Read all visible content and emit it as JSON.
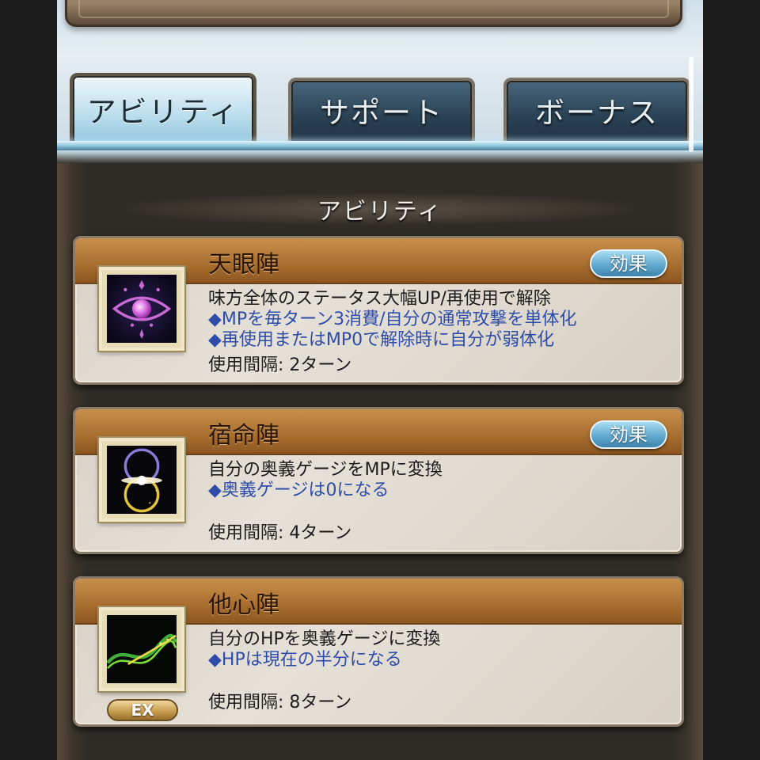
{
  "tabs": [
    {
      "label": "アビリティ",
      "active": true
    },
    {
      "label": "サポート",
      "active": false
    },
    {
      "label": "ボーナス",
      "active": false
    }
  ],
  "section_title": "アビリティ",
  "effect_label": "効果",
  "abilities": [
    {
      "name": "天眼陣",
      "has_effect_button": true,
      "lines": [
        {
          "text": "味方全体のステータス大幅UP/再使用で解除",
          "style": "normal"
        },
        {
          "text": "◆MPを毎ターン3消費/自分の通常攻撃を単体化",
          "style": "blue"
        },
        {
          "text": "◆再使用またはMP0で解除時に自分が弱体化",
          "style": "blue"
        }
      ],
      "interval": "使用間隔: 2ターン",
      "icon": "eye-icon"
    },
    {
      "name": "宿命陣",
      "has_effect_button": true,
      "lines": [
        {
          "text": "自分の奥義ゲージをMPに変換",
          "style": "normal"
        },
        {
          "text": "◆奥義ゲージは0になる",
          "style": "blue"
        }
      ],
      "interval": "使用間隔: 4ターン",
      "icon": "twin-rings-icon"
    },
    {
      "name": "他心陣",
      "has_effect_button": false,
      "lines": [
        {
          "text": "自分のHPを奥義ゲージに変換",
          "style": "normal"
        },
        {
          "text": "◆HPは現在の半分になる",
          "style": "blue"
        }
      ],
      "interval": "使用間隔: 8ターン",
      "icon": "energy-wave-icon",
      "badge": "EX"
    }
  ],
  "colors": {
    "tab_active": "#bfe0ee",
    "tab_inactive": "#2a4255",
    "card_title_bar": "#a86e2e",
    "effect_button": "#5ea6cc",
    "blue_text": "#2d4da8"
  }
}
